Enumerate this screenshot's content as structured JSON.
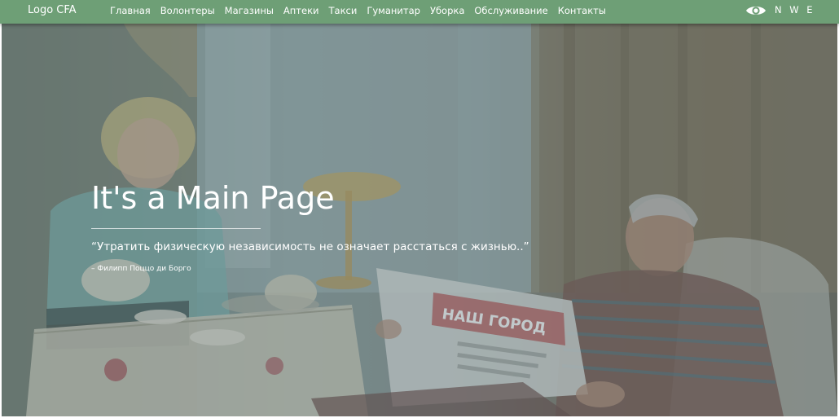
{
  "navbar": {
    "logo": "Logo CFA",
    "links": [
      "Главная",
      "Волонтеры",
      "Магазины",
      "Аптеки",
      "Такси",
      "Гуманитар",
      "Уборка",
      "Обслуживание",
      "Контакты"
    ],
    "accessibility_icon": "eye-icon",
    "language": "N W E",
    "background_color": "#6e9f76"
  },
  "hero": {
    "title": "It's a Main Page",
    "quote": "“Утратить физическую независимость не означает расстаться с жизнью..”",
    "author": "– Филипп Поццо ди Борго",
    "newspaper_headline": "НАШ ГОРОД"
  }
}
